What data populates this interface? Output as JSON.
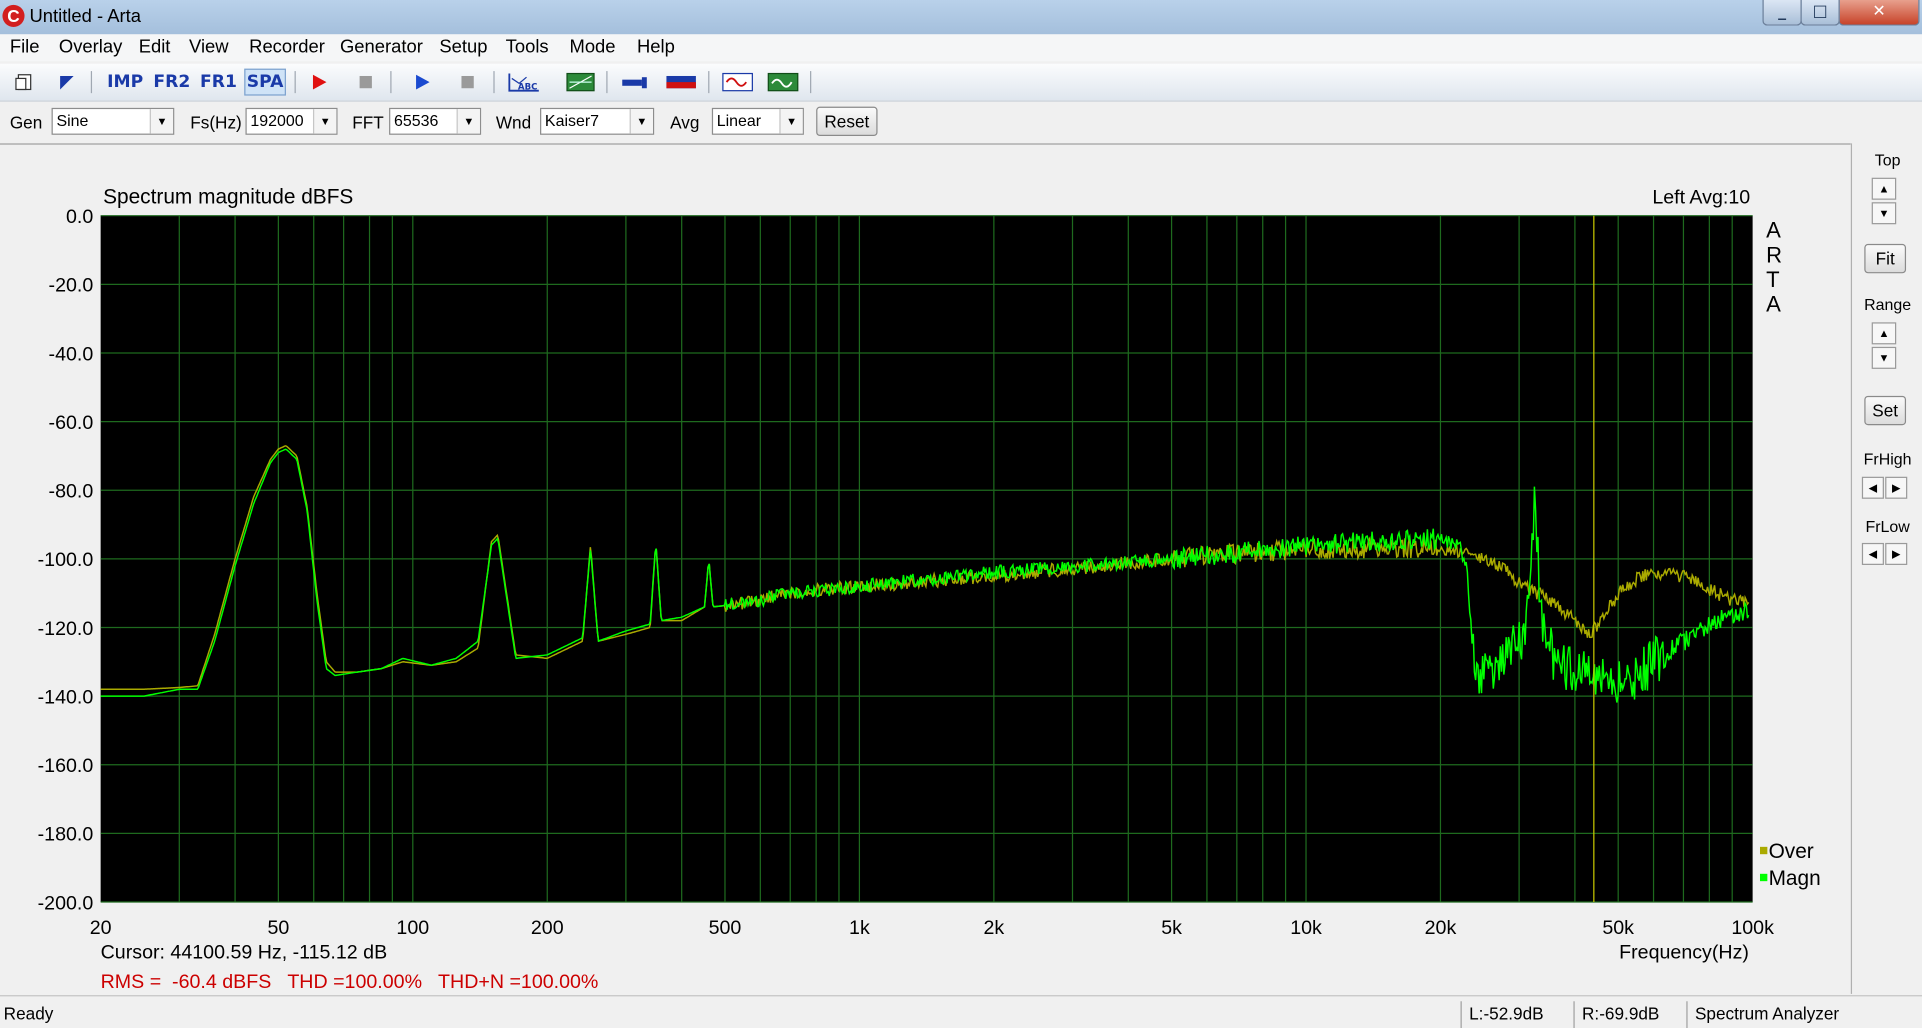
{
  "window": {
    "title": "Untitled - Arta",
    "app_icon_glyph": "C"
  },
  "menu": [
    "File",
    "Overlay",
    "Edit",
    "View",
    "Recorder",
    "Generator",
    "Setup",
    "Tools",
    "Mode",
    "Help"
  ],
  "toolbar": {
    "imp_label": "IMP",
    "fr2_label": "FR2",
    "fr1_label": "FR1",
    "spa_label": "SPA",
    "abc_label": "ABC",
    "icons": [
      "new-file-icon",
      "open-file-icon",
      "record-icon",
      "stop-icon",
      "play-icon",
      "stop-icon",
      "marker-abc-icon",
      "grid-icon",
      "probe-icon",
      "levels-icon",
      "oscilloscope-icon",
      "scope-green-icon"
    ]
  },
  "controls": {
    "gen_label": "Gen",
    "gen_value": "Sine",
    "fs_label": "Fs(Hz)",
    "fs_value": "192000",
    "fft_label": "FFT",
    "fft_value": "65536",
    "wnd_label": "Wnd",
    "wnd_value": "Kaiser7",
    "avg_label": "Avg",
    "avg_value": "Linear",
    "reset_label": "Reset"
  },
  "right_panel": {
    "top_label": "Top",
    "fit_label": "Fit",
    "range_label": "Range",
    "set_label": "Set",
    "frhigh_label": "FrHigh",
    "frlow_label": "FrLow"
  },
  "plot": {
    "title": "Spectrum magnitude dBFS",
    "channel_info": "Left   Avg:10",
    "watermark": [
      "A",
      "R",
      "T",
      "A"
    ],
    "cursor_text": "Cursor: 44100.59 Hz, -115.12 dB",
    "measurements_text": "RMS =  -60.4 dBFS   THD =100.00%   THD+N =100.00%",
    "colors": {
      "background": "#000000",
      "grid": "#1e6a1e",
      "magn": "#00ff00",
      "over": "#aaaa00",
      "cursor": "#c8c800",
      "measure_text": "#cc0000"
    }
  },
  "chart_data": {
    "type": "line",
    "title": "Spectrum magnitude dBFS",
    "xlabel": "Frequency(Hz)",
    "ylabel": "",
    "x_scale": "log",
    "xlim": [
      20,
      100000
    ],
    "ylim": [
      -200,
      0
    ],
    "x_ticks": [
      "20",
      "50",
      "100",
      "200",
      "500",
      "1k",
      "2k",
      "5k",
      "10k",
      "20k",
      "50k",
      "100k"
    ],
    "y_ticks": [
      "0.0",
      "-20.0",
      "-40.0",
      "-60.0",
      "-80.0",
      "-100.0",
      "-120.0",
      "-140.0",
      "-160.0",
      "-180.0",
      "-200.0"
    ],
    "legend": [
      "Over",
      "Magn"
    ],
    "legend_position": "bottom-right",
    "cursor_x": 44100.59,
    "series": [
      {
        "name": "Over",
        "points": [
          [
            20,
            -138
          ],
          [
            25,
            -138
          ],
          [
            30,
            -137.5
          ],
          [
            33,
            -137
          ],
          [
            36,
            -122
          ],
          [
            40,
            -100
          ],
          [
            44,
            -82
          ],
          [
            48,
            -71
          ],
          [
            50,
            -68
          ],
          [
            52,
            -67
          ],
          [
            55,
            -70
          ],
          [
            58,
            -85
          ],
          [
            61,
            -110
          ],
          [
            64,
            -130
          ],
          [
            67,
            -133
          ],
          [
            75,
            -133
          ],
          [
            85,
            -132
          ],
          [
            95,
            -130
          ],
          [
            110,
            -131
          ],
          [
            125,
            -130
          ],
          [
            140,
            -126
          ],
          [
            150,
            -95
          ],
          [
            155,
            -93
          ],
          [
            160,
            -105
          ],
          [
            170,
            -128
          ],
          [
            200,
            -129
          ],
          [
            240,
            -124
          ],
          [
            250,
            -96
          ],
          [
            260,
            -124
          ],
          [
            300,
            -122
          ],
          [
            340,
            -120
          ],
          [
            350,
            -95
          ],
          [
            360,
            -118
          ],
          [
            400,
            -118
          ],
          [
            450,
            -114
          ],
          [
            460,
            -100
          ],
          [
            470,
            -114
          ],
          [
            550,
            -113
          ],
          [
            700,
            -110
          ],
          [
            1000,
            -108
          ],
          [
            2000,
            -105
          ],
          [
            5000,
            -100
          ],
          [
            10000,
            -97
          ],
          [
            20000,
            -97
          ],
          [
            25000,
            -100
          ],
          [
            28000,
            -103
          ],
          [
            30000,
            -107
          ],
          [
            35000,
            -112
          ],
          [
            40000,
            -118
          ],
          [
            43000,
            -122
          ],
          [
            46000,
            -118
          ],
          [
            50000,
            -110
          ],
          [
            55000,
            -106
          ],
          [
            60000,
            -104
          ],
          [
            70000,
            -105
          ],
          [
            80000,
            -109
          ],
          [
            90000,
            -112
          ],
          [
            98000,
            -113
          ]
        ]
      },
      {
        "name": "Magn",
        "points": [
          [
            20,
            -140
          ],
          [
            25,
            -140
          ],
          [
            30,
            -138
          ],
          [
            33,
            -138
          ],
          [
            36,
            -124
          ],
          [
            40,
            -102
          ],
          [
            44,
            -84
          ],
          [
            48,
            -72
          ],
          [
            50,
            -69
          ],
          [
            52,
            -68
          ],
          [
            55,
            -71
          ],
          [
            58,
            -86
          ],
          [
            61,
            -112
          ],
          [
            64,
            -132
          ],
          [
            67,
            -134
          ],
          [
            75,
            -133
          ],
          [
            85,
            -132
          ],
          [
            95,
            -129
          ],
          [
            110,
            -131
          ],
          [
            125,
            -129
          ],
          [
            140,
            -124
          ],
          [
            150,
            -96
          ],
          [
            155,
            -94
          ],
          [
            160,
            -106
          ],
          [
            170,
            -129
          ],
          [
            200,
            -128
          ],
          [
            240,
            -123
          ],
          [
            250,
            -97
          ],
          [
            260,
            -124
          ],
          [
            300,
            -121
          ],
          [
            340,
            -119
          ],
          [
            350,
            -95
          ],
          [
            360,
            -118
          ],
          [
            400,
            -117
          ],
          [
            450,
            -114
          ],
          [
            460,
            -100
          ],
          [
            470,
            -114
          ],
          [
            550,
            -113
          ],
          [
            700,
            -110
          ],
          [
            1000,
            -108
          ],
          [
            2000,
            -104
          ],
          [
            5000,
            -100
          ],
          [
            10000,
            -96
          ],
          [
            20000,
            -94
          ],
          [
            22000,
            -95
          ],
          [
            23000,
            -105
          ],
          [
            24000,
            -135
          ],
          [
            26000,
            -132
          ],
          [
            28000,
            -128
          ],
          [
            30000,
            -125
          ],
          [
            31500,
            -115
          ],
          [
            32500,
            -80
          ],
          [
            33500,
            -115
          ],
          [
            36000,
            -130
          ],
          [
            40000,
            -133
          ],
          [
            45000,
            -135
          ],
          [
            50000,
            -136
          ],
          [
            55000,
            -134
          ],
          [
            60000,
            -130
          ],
          [
            70000,
            -124
          ],
          [
            80000,
            -119
          ],
          [
            90000,
            -116
          ],
          [
            98000,
            -115
          ]
        ]
      }
    ]
  }
}
